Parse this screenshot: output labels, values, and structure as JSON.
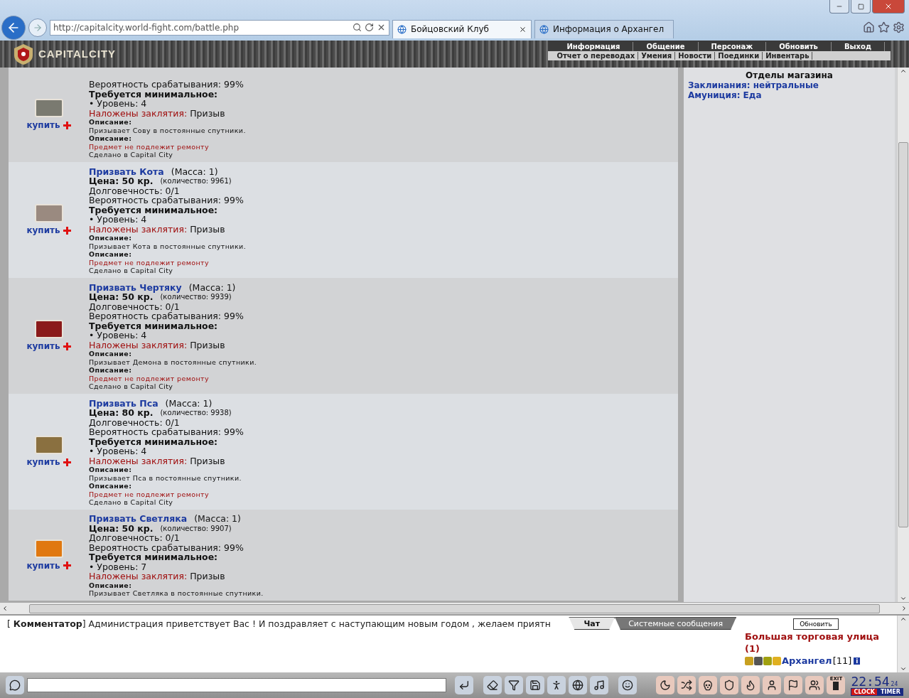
{
  "browser": {
    "address": "http://capitalcity.world-fight.com/battle.php",
    "tabs": [
      {
        "title": "Бойцовский Клуб",
        "selected": true
      },
      {
        "title": "Информация о Архангел",
        "selected": false
      }
    ]
  },
  "game_header": {
    "logo": "CAPITALCITY",
    "menu": [
      "Информация",
      "Общение",
      "Персонаж",
      "Обновить",
      "Выход"
    ],
    "submenu": [
      "Отчет о переводах",
      "Умения",
      "Новости",
      "Поединки",
      "Инвентарь"
    ]
  },
  "items": [
    {
      "buy": "купить",
      "chance": "Вероятность срабатывания: 99%",
      "requirement": "Требуется минимальное:",
      "level": "• Уровень: 4",
      "spell_label": "Наложены заклятия:",
      "spell": "Призыв",
      "desc_label": "Описание:",
      "desc": "Призывает Сову в постоянные спутники.",
      "desc2_label": "Описание:",
      "repair": "Предмет не подлежит ремонту",
      "made": "Сделано в Capital City"
    },
    {
      "buy": "купить",
      "name": "Призвать Кота",
      "mass": "(Масса: 1)",
      "price": "Цена: 50 кр.",
      "quantity": "(количество: 9961)",
      "durability": "Долговечность: 0/1",
      "chance": "Вероятность срабатывания: 99%",
      "requirement": "Требуется минимальное:",
      "level": "• Уровень: 4",
      "spell_label": "Наложены заклятия:",
      "spell": "Призыв",
      "desc_label": "Описание:",
      "desc": "Призывает Кота в постоянные спутники.",
      "desc2_label": "Описание:",
      "repair": "Предмет не подлежит ремонту",
      "made": "Сделано в Capital City"
    },
    {
      "buy": "купить",
      "name": "Призвать Чертяку",
      "mass": "(Масса: 1)",
      "price": "Цена: 50 кр.",
      "quantity": "(количество: 9939)",
      "durability": "Долговечность: 0/1",
      "chance": "Вероятность срабатывания: 99%",
      "requirement": "Требуется минимальное:",
      "level": "• Уровень: 4",
      "spell_label": "Наложены заклятия:",
      "spell": "Призыв",
      "desc_label": "Описание:",
      "desc": "Призывает Демона в постоянные спутники.",
      "desc2_label": "Описание:",
      "repair": "Предмет не подлежит ремонту",
      "made": "Сделано в Capital City"
    },
    {
      "buy": "купить",
      "name": "Призвать Пса",
      "mass": "(Масса: 1)",
      "price": "Цена: 80 кр.",
      "quantity": "(количество: 9938)",
      "durability": "Долговечность: 0/1",
      "chance": "Вероятность срабатывания: 99%",
      "requirement": "Требуется минимальное:",
      "level": "• Уровень: 4",
      "spell_label": "Наложены заклятия:",
      "spell": "Призыв",
      "desc_label": "Описание:",
      "desc": "Призывает Пса в постоянные спутники.",
      "desc2_label": "Описание:",
      "repair": "Предмет не подлежит ремонту",
      "made": "Сделано в Capital City"
    },
    {
      "buy": "купить",
      "name": "Призвать Светляка",
      "mass": "(Масса: 1)",
      "price": "Цена: 50 кр.",
      "quantity": "(количество: 9907)",
      "durability": "Долговечность: 0/1",
      "chance": "Вероятность срабатывания: 99%",
      "requirement": "Требуется минимальное:",
      "level": "• Уровень: 7",
      "spell_label": "Наложены заклятия:",
      "spell": "Призыв",
      "desc_label": "Описание:",
      "desc": "Призывает Светляка в постоянные спутники."
    }
  ],
  "shop_sections": {
    "title": "Отделы магазина",
    "links": [
      "Заклинания: нейтральные",
      "Амуниция: Еда"
    ]
  },
  "chat": {
    "message": "[ **Комментатор**] Администрация приветствует Вас ! И поздравляет с наступающим новым годом , желаем приятн",
    "tabs": [
      {
        "label": "Чат",
        "selected": true
      },
      {
        "label": "Системные сообщения",
        "selected": false
      }
    ],
    "refresh": "Обновить",
    "location": "Большая торговая улица",
    "location_count": "(1)",
    "user": "Архангел",
    "user_level": "[11]",
    "info_badge": "i"
  },
  "toolbar": {
    "clock": "22:54",
    "clock_small": "24",
    "modes": [
      {
        "label": "CLOCK",
        "selected": true
      },
      {
        "label": "TIMER",
        "selected": false
      }
    ],
    "exit_label": "EXIT"
  }
}
